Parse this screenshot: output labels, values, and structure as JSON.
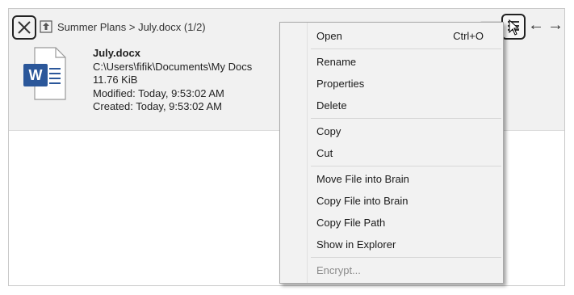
{
  "header": {
    "breadcrumb": "Summer Plans > July.docx (1/2)",
    "nav_back": "←",
    "nav_forward": "→"
  },
  "file": {
    "name": "July.docx",
    "path": "C:\\Users\\fifik\\Documents\\My Docs",
    "size": "11.76 KiB",
    "modified": "Modified: Today, 9:53:02 AM",
    "created": "Created: Today, 9:53:02 AM",
    "icon_letter": "W"
  },
  "context_menu": {
    "open": "Open",
    "open_shortcut": "Ctrl+O",
    "rename": "Rename",
    "properties": "Properties",
    "delete": "Delete",
    "copy": "Copy",
    "cut": "Cut",
    "move_into_brain": "Move File into Brain",
    "copy_into_brain": "Copy File into Brain",
    "copy_path": "Copy File Path",
    "show_in_explorer": "Show in Explorer",
    "encrypt": "Encrypt..."
  },
  "colors": {
    "word_blue": "#2b579a",
    "menu_bg": "#f2f2f2",
    "disabled_text": "#8a8a8a"
  }
}
